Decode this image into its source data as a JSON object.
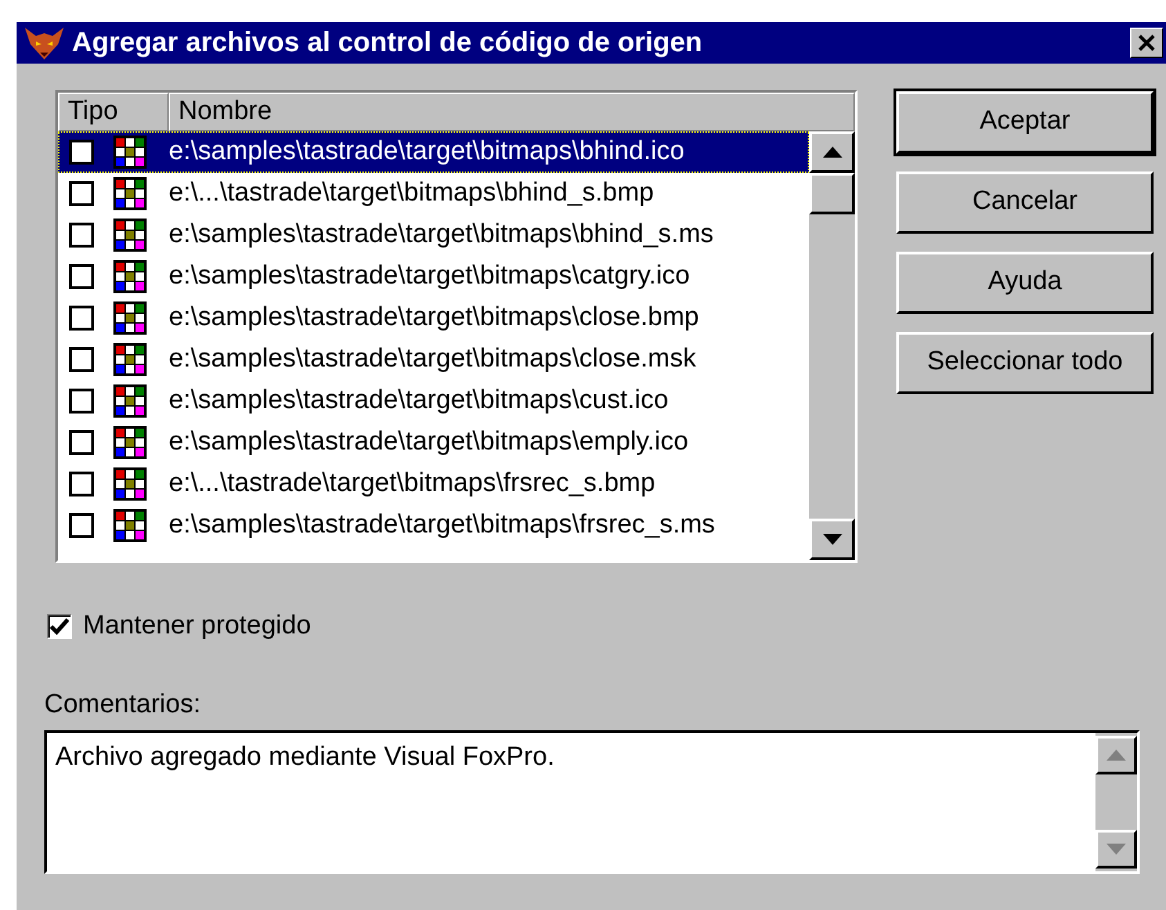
{
  "window": {
    "title": "Agregar archivos al control de código de origen"
  },
  "list": {
    "columns": [
      "Tipo",
      "Nombre"
    ],
    "rows": [
      {
        "checked": false,
        "selected": true,
        "name": "e:\\samples\\tastrade\\target\\bitmaps\\bhind.ico"
      },
      {
        "checked": false,
        "selected": false,
        "name": "e:\\...\\tastrade\\target\\bitmaps\\bhind_s.bmp"
      },
      {
        "checked": false,
        "selected": false,
        "name": "e:\\samples\\tastrade\\target\\bitmaps\\bhind_s.ms"
      },
      {
        "checked": false,
        "selected": false,
        "name": "e:\\samples\\tastrade\\target\\bitmaps\\catgry.ico"
      },
      {
        "checked": false,
        "selected": false,
        "name": "e:\\samples\\tastrade\\target\\bitmaps\\close.bmp"
      },
      {
        "checked": false,
        "selected": false,
        "name": "e:\\samples\\tastrade\\target\\bitmaps\\close.msk"
      },
      {
        "checked": false,
        "selected": false,
        "name": "e:\\samples\\tastrade\\target\\bitmaps\\cust.ico"
      },
      {
        "checked": false,
        "selected": false,
        "name": "e:\\samples\\tastrade\\target\\bitmaps\\emply.ico"
      },
      {
        "checked": false,
        "selected": false,
        "name": "e:\\...\\tastrade\\target\\bitmaps\\frsrec_s.bmp"
      },
      {
        "checked": false,
        "selected": false,
        "name": "e:\\samples\\tastrade\\target\\bitmaps\\frsrec_s.ms"
      }
    ]
  },
  "buttons": [
    {
      "label": "Aceptar",
      "default": true
    },
    {
      "label": "Cancelar",
      "default": false
    },
    {
      "label": "Ayuda",
      "default": false
    },
    {
      "label": "Seleccionar todo",
      "default": false
    }
  ],
  "keep_protected": {
    "label": "Mantener protegido",
    "checked": true
  },
  "comments": {
    "label": "Comentarios:",
    "value": "Archivo agregado mediante Visual FoxPro."
  }
}
